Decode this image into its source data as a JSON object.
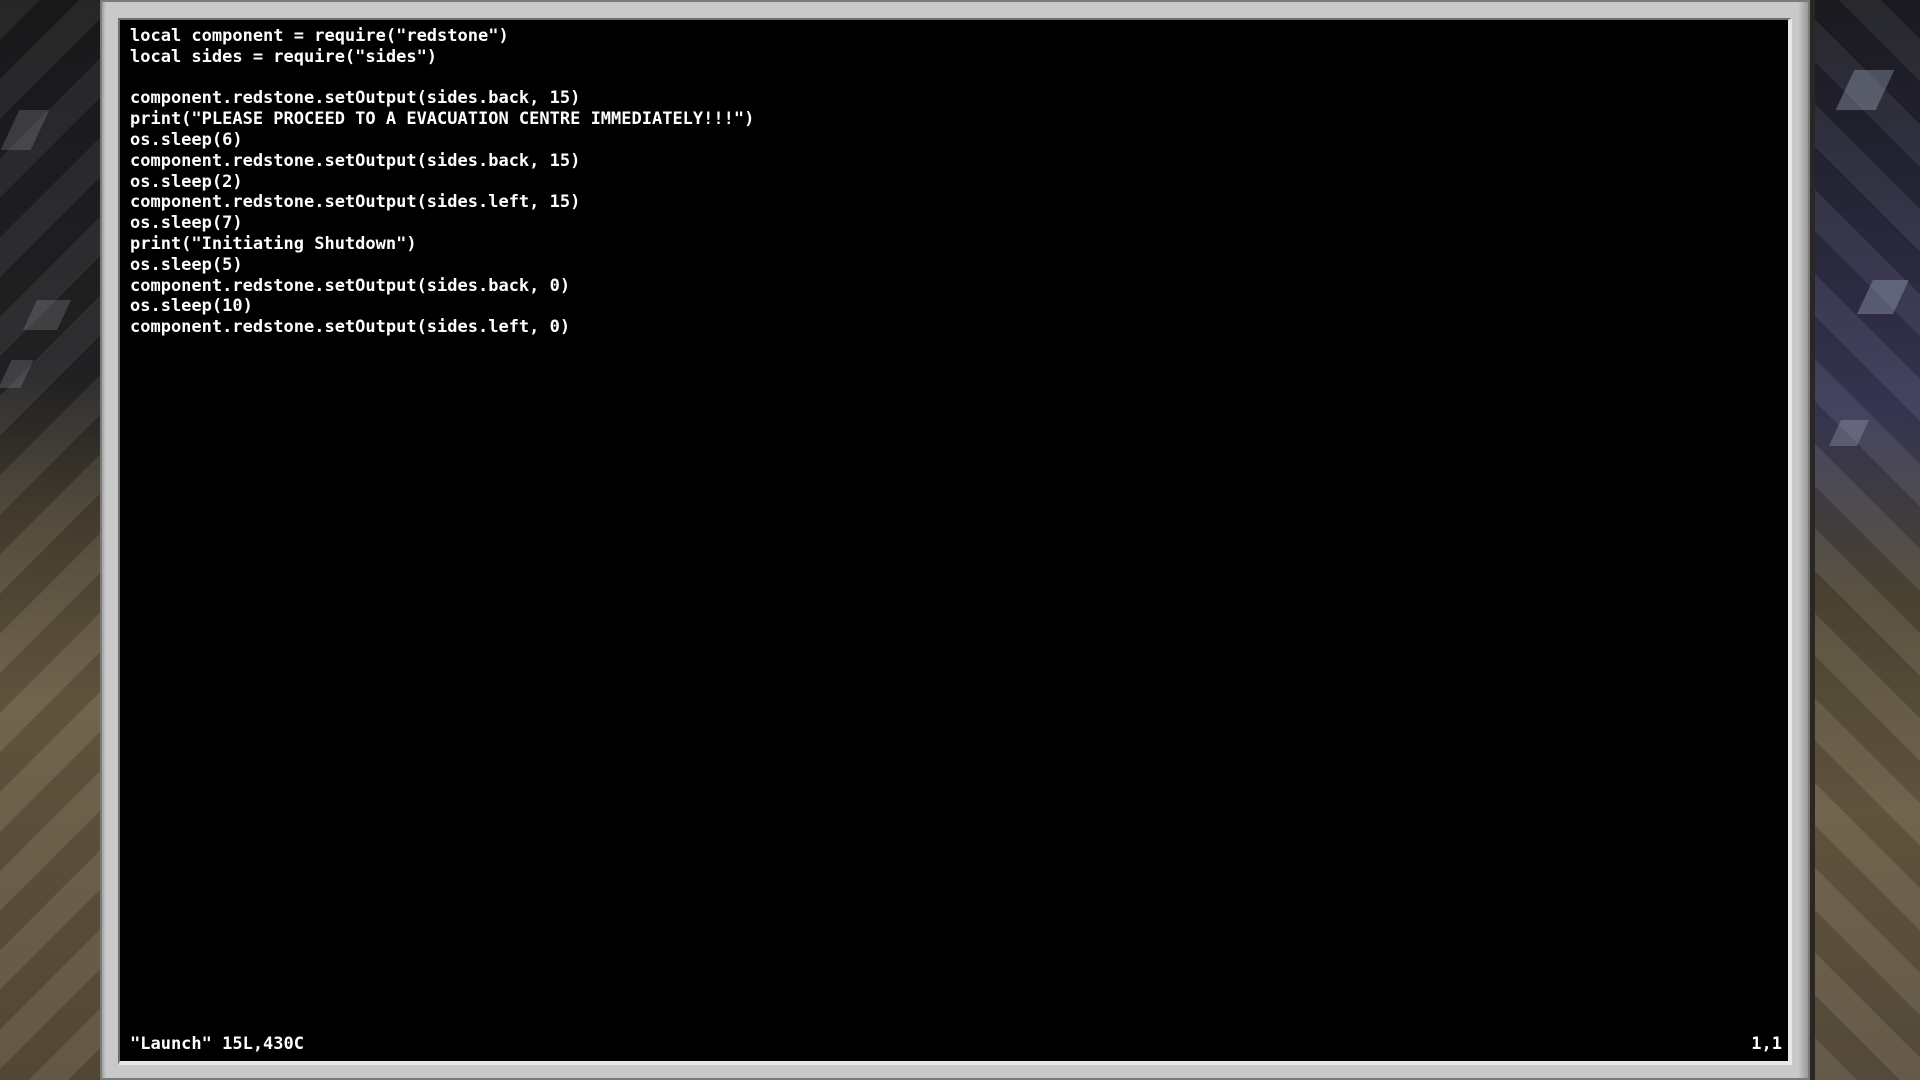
{
  "editor": {
    "lines": [
      "local component = require(\"redstone\")",
      "local sides = require(\"sides\")",
      "",
      "component.redstone.setOutput(sides.back, 15)",
      "print(\"PLEASE PROCEED TO A EVACUATION CENTRE IMMEDIATELY!!!\")",
      "os.sleep(6)",
      "component.redstone.setOutput(sides.back, 15)",
      "os.sleep(2)",
      "component.redstone.setOutput(sides.left, 15)",
      "os.sleep(7)",
      "print(\"Initiating Shutdown\")",
      "os.sleep(5)",
      "component.redstone.setOutput(sides.back, 0)",
      "os.sleep(10)",
      "component.redstone.setOutput(sides.left, 0)"
    ]
  },
  "status": {
    "file_info": "\"Launch\" 15L,430C",
    "cursor_position": "1,1"
  },
  "colors": {
    "screen_background": "#000000",
    "text": "#ffffff",
    "monitor_frame": "#c9c9c9"
  }
}
